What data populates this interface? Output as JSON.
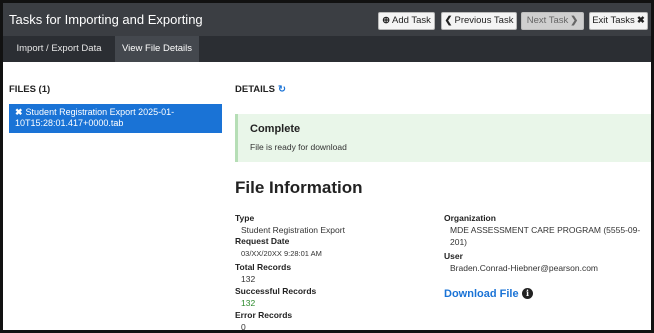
{
  "header": {
    "title": "Tasks for Importing and Exporting",
    "add_task": "Add Task",
    "previous_task": "Previous Task",
    "next_task": "Next Task",
    "exit_tasks": "Exit Tasks",
    "add_icon": "plus-circle-icon",
    "prev_icon": "chevron-left-icon",
    "next_icon": "chevron-right-icon",
    "exit_icon": "close-icon"
  },
  "tabs": [
    {
      "label": "Import / Export Data",
      "active": false
    },
    {
      "label": "View File Details",
      "active": true
    }
  ],
  "files": {
    "heading": "FILES (1)",
    "items": [
      {
        "name": "Student Registration Export 2025-01-10T15:28:01.417+0000.tab",
        "selected": true
      }
    ]
  },
  "details": {
    "heading": "DETAILS",
    "refresh_icon": "refresh-icon",
    "status_title": "Complete",
    "status_message": "File is ready for download",
    "info_title": "File Information",
    "fields_left": [
      {
        "label": "Type",
        "value": "Student Registration Export"
      },
      {
        "label": "Request Date",
        "value": "03/XX/20XX 9:28:01 AM"
      },
      {
        "label": "Total Records",
        "value": "132"
      },
      {
        "label": "Successful Records",
        "value": "132"
      },
      {
        "label": "Error Records",
        "value": "0"
      }
    ],
    "fields_right": [
      {
        "label": "Organization",
        "value": "MDE ASSESSMENT CARE PROGRAM (5555-09-",
        "value_cont": "201)"
      },
      {
        "label": "User",
        "value": "Braden.Conrad-Hiebner@pearson.com"
      }
    ],
    "download_label": "Download File",
    "download_info_icon": "info-circle-icon"
  },
  "colors": {
    "topbar": "#3b3e43",
    "tabbar": "#2b2e33",
    "accent": "#1a73d6",
    "success_bg": "#e9f6e9",
    "success_text": "#2e8b2e"
  }
}
